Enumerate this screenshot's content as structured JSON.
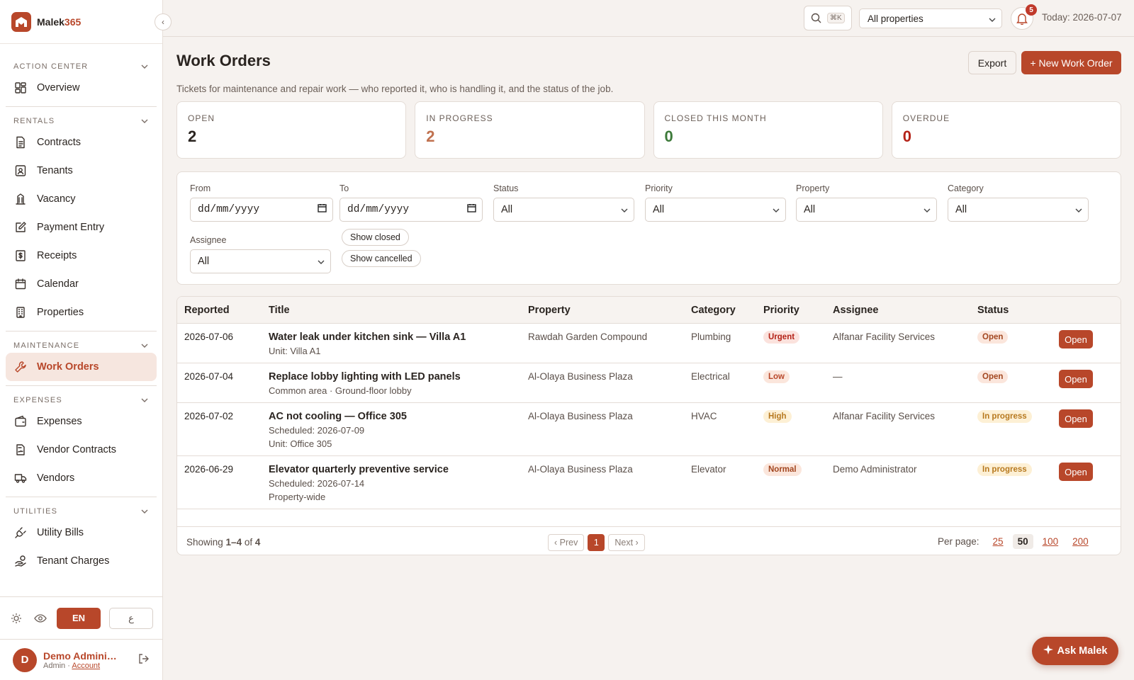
{
  "brand": {
    "name_prefix": "Malek",
    "name_suffix": "365"
  },
  "sidebar": {
    "sections": [
      {
        "title": "ACTION CENTER",
        "items": [
          {
            "label": "Overview",
            "icon": "grid-icon"
          }
        ]
      },
      {
        "title": "RENTALS",
        "items": [
          {
            "label": "Contracts",
            "icon": "document-icon"
          },
          {
            "label": "Tenants",
            "icon": "id-card-icon"
          },
          {
            "label": "Vacancy",
            "icon": "building-icon"
          },
          {
            "label": "Payment Entry",
            "icon": "edit-icon"
          },
          {
            "label": "Receipts",
            "icon": "receipt-icon"
          },
          {
            "label": "Calendar",
            "icon": "calendar-icon"
          },
          {
            "label": "Properties",
            "icon": "office-icon"
          }
        ]
      },
      {
        "title": "MAINTENANCE",
        "items": [
          {
            "label": "Work Orders",
            "icon": "wrench-icon",
            "active": true
          }
        ]
      },
      {
        "title": "EXPENSES",
        "items": [
          {
            "label": "Expenses",
            "icon": "wallet-icon"
          },
          {
            "label": "Vendor Contracts",
            "icon": "signed-doc-icon"
          },
          {
            "label": "Vendors",
            "icon": "truck-icon"
          }
        ]
      },
      {
        "title": "UTILITIES",
        "items": [
          {
            "label": "Utility Bills",
            "icon": "plug-icon"
          },
          {
            "label": "Tenant Charges",
            "icon": "hand-coins-icon"
          }
        ]
      }
    ],
    "lang_en": "EN",
    "lang_ar": "ع",
    "user": {
      "initial": "D",
      "name": "Demo Administrator",
      "role": "Admin",
      "sep": " · ",
      "account_link": "Account"
    }
  },
  "topbar": {
    "search_shortcut": "⌘K",
    "property_filter": "All properties",
    "notification_count": "5",
    "today": "Today: 2026-07-07"
  },
  "page": {
    "title": "Work Orders",
    "subtitle": "Tickets for maintenance and repair work — who reported it, who is handling it, and the status of the job.",
    "export_label": "Export",
    "new_label": "+ New Work Order"
  },
  "stats": [
    {
      "label": "OPEN",
      "value": "2",
      "color": "#2a2420"
    },
    {
      "label": "IN PROGRESS",
      "value": "2",
      "color": "#c0714f"
    },
    {
      "label": "CLOSED THIS MONTH",
      "value": "0",
      "color": "#3d7a3a"
    },
    {
      "label": "OVERDUE",
      "value": "0",
      "color": "#b42318"
    }
  ],
  "filters": {
    "from_label": "From",
    "from_value": "dd/mm/yyyy",
    "to_label": "To",
    "to_value": "dd/mm/yyyy",
    "status_label": "Status",
    "status_value": "All",
    "priority_label": "Priority",
    "priority_value": "All",
    "property_label": "Property",
    "property_value": "All",
    "category_label": "Category",
    "category_value": "All",
    "assignee_label": "Assignee",
    "assignee_value": "All",
    "show_closed": "Show closed",
    "show_cancelled": "Show cancelled"
  },
  "table": {
    "headers": {
      "reported": "Reported",
      "title": "Title",
      "property": "Property",
      "category": "Category",
      "priority": "Priority",
      "assignee": "Assignee",
      "status": "Status"
    },
    "open_label": "Open",
    "rows": [
      {
        "reported": "2026-07-06",
        "title": "Water leak under kitchen sink — Villa A1",
        "sub": [
          "Unit: Villa A1"
        ],
        "property": "Rawdah Garden Compound",
        "category": "Plumbing",
        "priority": "Urgent",
        "priority_level": "urgent",
        "assignee": "Alfanar Facility Services",
        "status": "Open",
        "status_level": "open"
      },
      {
        "reported": "2026-07-04",
        "title": "Replace lobby lighting with LED panels",
        "sub": [
          "Common area · Ground-floor lobby"
        ],
        "property": "Al-Olaya Business Plaza",
        "category": "Electrical",
        "priority": "Low",
        "priority_level": "low",
        "assignee": "—",
        "status": "Open",
        "status_level": "open"
      },
      {
        "reported": "2026-07-02",
        "title": "AC not cooling — Office 305",
        "sub": [
          "Scheduled: 2026-07-09",
          "Unit: Office 305"
        ],
        "property": "Al-Olaya Business Plaza",
        "category": "HVAC",
        "priority": "High",
        "priority_level": "high",
        "assignee": "Alfanar Facility Services",
        "status": "In progress",
        "status_level": "progress"
      },
      {
        "reported": "2026-06-29",
        "title": "Elevator quarterly preventive service",
        "sub": [
          "Scheduled: 2026-07-14",
          "Property-wide"
        ],
        "property": "Al-Olaya Business Plaza",
        "category": "Elevator",
        "priority": "Normal",
        "priority_level": "normal",
        "assignee": "Demo Administrator",
        "status": "In progress",
        "status_level": "progress"
      }
    ]
  },
  "pagination": {
    "showing_prefix": "Showing ",
    "showing_range": "1–4",
    "showing_of": " of ",
    "showing_total": "4",
    "prev": "‹ Prev",
    "page": "1",
    "next": "Next ›",
    "per_page_label": "Per page:",
    "per_page_options": [
      "25",
      "50",
      "100",
      "200"
    ],
    "per_page_selected": "50"
  },
  "ask": {
    "label": "Ask Malek"
  }
}
